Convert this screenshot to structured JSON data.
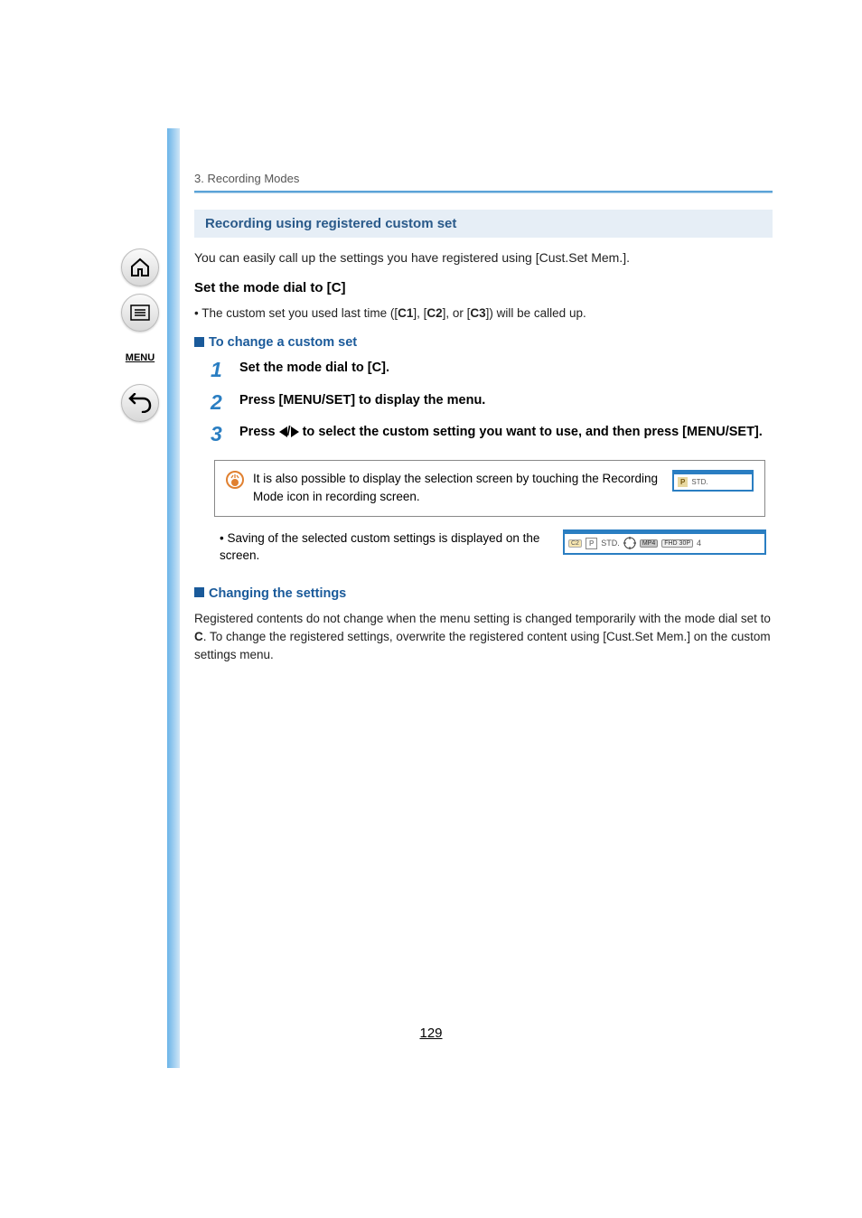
{
  "sidebar": {
    "menu_label": "MENU"
  },
  "chapter": {
    "title": "3. Recording Modes"
  },
  "section": {
    "heading": "Recording using registered custom set",
    "intro": "You can easily call up the settings you have registered using [Cust.Set Mem.].",
    "set_dial_prefix": "Set the mode dial to [",
    "set_dial_symbol": "C",
    "set_dial_suffix": "]",
    "dial_note_prefix": "• The custom set you used last time ([",
    "c1": "C1",
    "dial_note_sep": "], [",
    "c2": "C2",
    "dial_note_sep2": "], or [",
    "c3": "C3",
    "dial_note_suffix": "]) will be called up.",
    "change_heading": "To change a custom set"
  },
  "steps": [
    {
      "num": "1",
      "text_a": "Set the mode dial to [",
      "symbol": "C",
      "text_b": "]."
    },
    {
      "num": "2",
      "text_a": "Press [MENU/SET] to display the menu.",
      "symbol": "",
      "text_b": ""
    },
    {
      "num": "3",
      "text_a": "Press ",
      "symbol": "",
      "text_b": " to select the custom setting you want to use, and then press [MENU/SET]."
    }
  ],
  "note_box": {
    "text": "It is also possible to display the selection screen by touching the Recording Mode icon in recording screen."
  },
  "saving_note": "• Saving of the selected custom settings is displayed on the screen.",
  "changing": {
    "heading": "Changing the settings",
    "body_a": "Registered contents do not change when the menu setting is changed temporarily with the mode dial set to ",
    "symbol": "C",
    "body_b": ". To change the registered settings, overwrite the registered content using [Cust.Set Mem.] on the custom settings menu."
  },
  "thumb_labels": {
    "p": "P",
    "std": "STD.",
    "c2": "C2",
    "mp4": "MP4",
    "fhd": "FHD 30P",
    "four": "4"
  },
  "page_number": "129"
}
